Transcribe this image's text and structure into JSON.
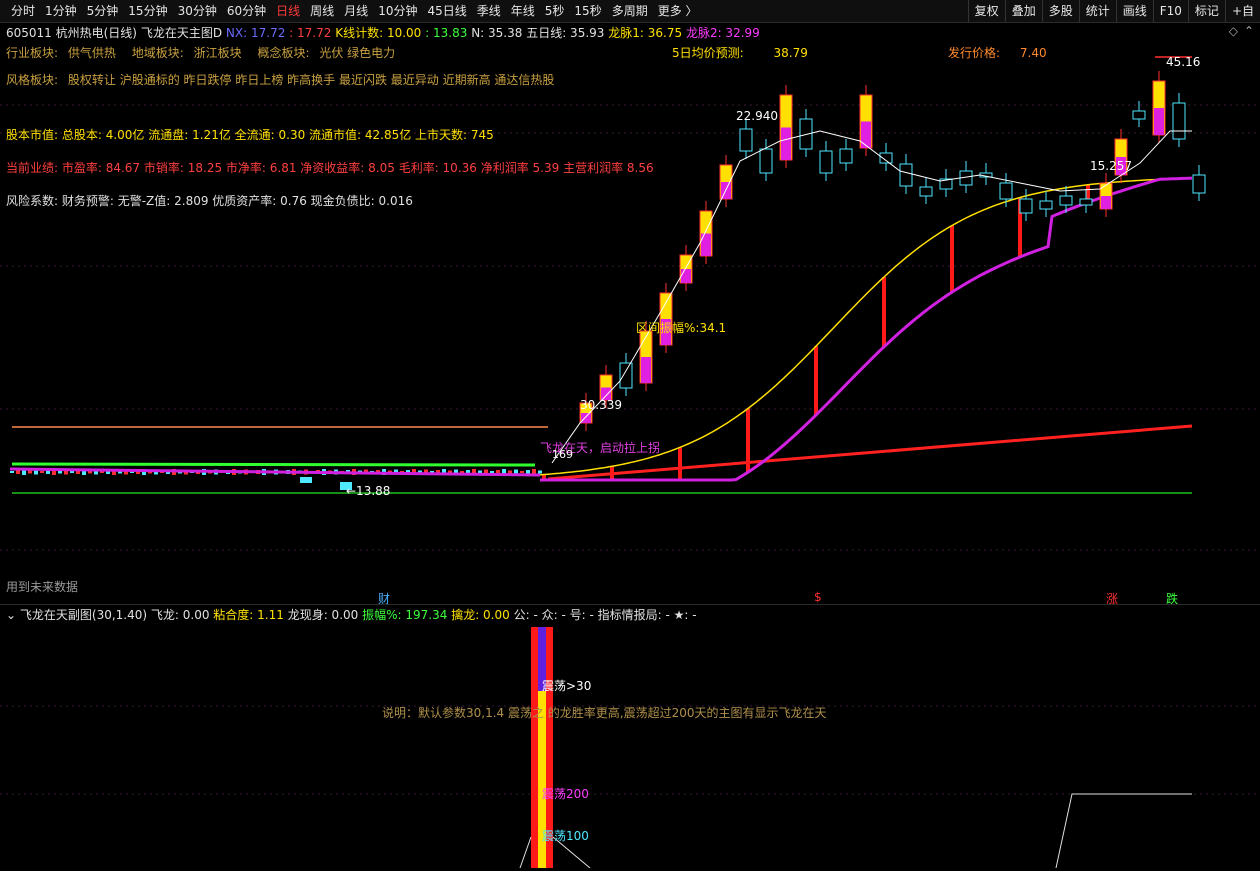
{
  "toolbar": {
    "tabs": [
      "分时",
      "1分钟",
      "5分钟",
      "15分钟",
      "30分钟",
      "60分钟",
      "日线",
      "周线",
      "月线",
      "10分钟",
      "45日线",
      "季线",
      "年线",
      "5秒",
      "15秒",
      "多周期",
      "更多 〉"
    ],
    "active_tab": "日线",
    "tools": [
      "复权",
      "叠加",
      "多股",
      "统计",
      "画线",
      "F10",
      "标记",
      "+自"
    ]
  },
  "header": {
    "code_name": "605011 杭州热电(日线)",
    "indicator": "飞龙在天主图D",
    "nx_label": "NX:",
    "nx1": "17.72",
    "nx2": ": 17.72",
    "kcount": "K线计数: 10.00",
    "kval": ": 13.83",
    "n": "N: 35.38",
    "five": "五日线: 35.93",
    "dragon1": "龙脉1: 36.75",
    "dragon2": "龙脉2: 32.99",
    "diamond": "◇",
    "nav": "⌃"
  },
  "info": {
    "industry_label": "行业板块:",
    "industry": [
      "供气供热"
    ],
    "region_label": "地域板块:",
    "region": [
      "浙江板块"
    ],
    "concept_label": "概念板块:",
    "concept": "光伏 绿色电力",
    "style_label": "风格板块:",
    "style": "股权转让 沪股通标的 昨日跌停 昨日上榜 昨高换手 最近闪跌 最近异动 近期新高 通达信热股",
    "forecast_label": "5日均价预测:",
    "forecast_value": "38.79",
    "issue_label": "发行价格:",
    "issue_value": "7.40",
    "capital": "股本市值: 总股本: 4.00亿 流通盘: 1.21亿 全流通: 0.30 流通市值: 42.85亿 上市天数: 745",
    "perf": "当前业绩: 市盈率: 84.67 市销率: 18.25 市净率: 6.81 净资收益率: 8.05 毛利率: 10.36 净利润率 5.39 主营利润率 8.56",
    "risk": "风险系数: 财务预警: 无警-Z值: 2.809 优质资产率: 0.76 现金负债比: 0.016"
  },
  "chart_labels": {
    "high": "45.16",
    "p22": "22.940",
    "p15": "15.257",
    "p30": "30.339",
    "amp": "区间振幅%:34.1",
    "flying": "飞龙在天，启动拉上拐",
    "low": "←13.88",
    "p169": "169",
    "future": "用到未来数据",
    "marks": [
      "财",
      "$",
      "涨",
      "跌"
    ]
  },
  "sub": {
    "title": "飞龙在天副图(30,1.40)",
    "fl": "飞龙: 0.00",
    "nh": "粘合度: 1.11",
    "lxs": "龙现身: 0.00",
    "zf": "振幅%: 197.34",
    "ql": "擒龙: 0.00",
    "rest": "公: - 众: - 号: - 指标情报局: - ★: -",
    "d30": "震荡>30",
    "note": "说明：默认参数30,1.4 震荡之 的龙胜率更高,震荡超过200天的主图有显示飞龙在天",
    "d200": "震荡200",
    "d100": "震荡100"
  },
  "colors": {
    "up": "#ff3030",
    "down": "#4ee8ff",
    "yellow": "#ffe000",
    "magenta": "#e020e0",
    "green": "#20c020"
  }
}
